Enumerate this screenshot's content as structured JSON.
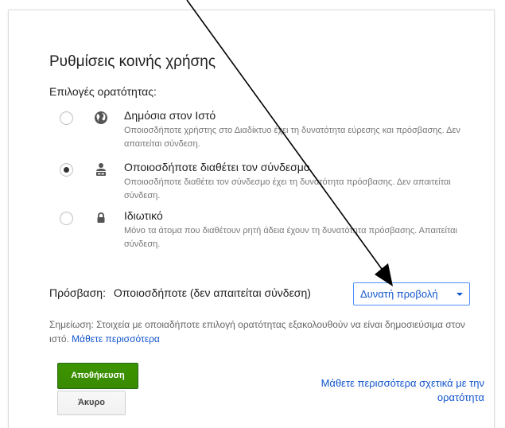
{
  "dialog": {
    "title": "Ρυθμίσεις κοινής χρήσης",
    "visibility_label": "Επιλογές ορατότητας:"
  },
  "options": [
    {
      "title": "Δημόσια στον Ιστό",
      "description": "Οποιοσδήποτε χρήστης στο Διαδίκτυο έχει τη δυνατότητα εύρεσης και πρόσβασης. Δεν απαιτείται σύνδεση.",
      "icon": "globe-icon",
      "selected": false
    },
    {
      "title": "Οποιοσδήποτε διαθέτει τον σύνδεσμο",
      "description": "Οποιοσδήποτε διαθέτει τον σύνδεσμο έχει τη δυνατότητα πρόσβασης. Δεν απαιτείται σύνδεση.",
      "icon": "person-link-icon",
      "selected": true
    },
    {
      "title": "Ιδιωτικό",
      "description": "Μόνο τα άτομα που διαθέτουν ρητή άδεια έχουν τη δυνατότητα πρόσβασης. Απαιτείται σύνδεση.",
      "icon": "lock-icon",
      "selected": false
    }
  ],
  "access": {
    "label": "Πρόσβαση:",
    "value": "Οποιοσδήποτε (δεν απαιτείται σύνδεση)",
    "dropdown_value": "Δυνατή προβολή"
  },
  "note": {
    "text": "Σημείωση: Στοιχεία με οποιαδήποτε επιλογή ορατότητας εξακολουθούν να είναι δημοσιεύσιμα στον ιστό.",
    "link": "Μάθετε περισσότερα"
  },
  "buttons": {
    "save": "Αποθήκευση",
    "cancel": "Άκυρο"
  },
  "learn_more_visibility": "Μάθετε περισσότερα σχετικά με την ορατότητα",
  "colors": {
    "link": "#1155cc",
    "save_button": "#3d9400",
    "dropdown_border": "#4d90fe"
  }
}
